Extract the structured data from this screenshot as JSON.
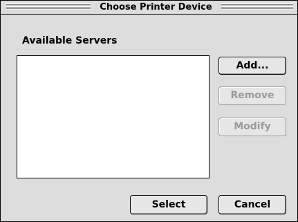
{
  "window": {
    "title": "Choose Printer Device"
  },
  "servers": {
    "label": "Available Servers",
    "items": []
  },
  "buttons": {
    "add": "Add...",
    "remove": "Remove",
    "modify": "Modify",
    "select": "Select",
    "cancel": "Cancel"
  },
  "state": {
    "remove_enabled": false,
    "modify_enabled": false
  }
}
